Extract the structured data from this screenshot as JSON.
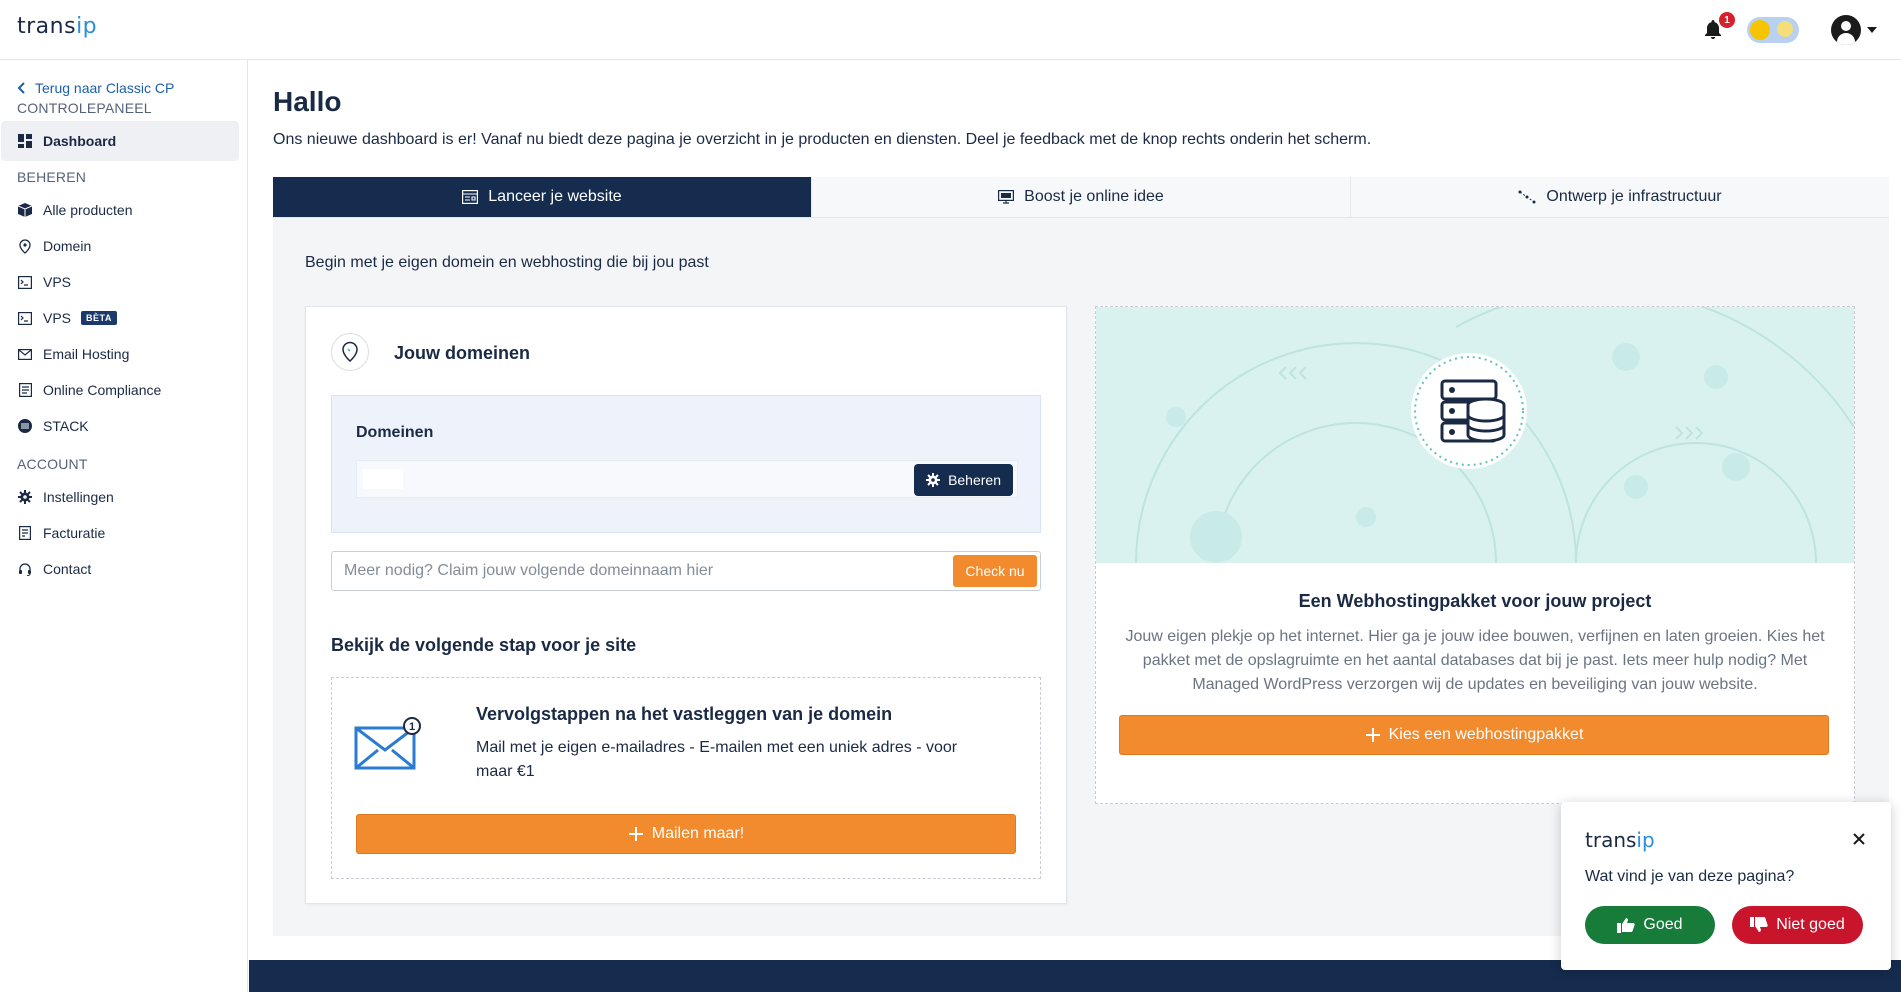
{
  "header": {
    "logo_trans": "trans",
    "logo_ip": "ip",
    "notifications_count": "1"
  },
  "sidebar": {
    "back_link": "Terug naar Classic CP",
    "sections": {
      "control": "CONTROLEPANEEL",
      "manage": "BEHEREN",
      "account": "ACCOUNT"
    },
    "items": [
      {
        "label": "Dashboard",
        "icon": "dashboard-icon"
      },
      {
        "label": "Alle producten",
        "icon": "box-icon"
      },
      {
        "label": "Domein",
        "icon": "location-pin-icon"
      },
      {
        "label": "VPS",
        "icon": "terminal-icon"
      },
      {
        "label": "VPS",
        "icon": "terminal-icon",
        "badge": "BÈTA"
      },
      {
        "label": "Email Hosting",
        "icon": "mail-icon"
      },
      {
        "label": "Online Compliance",
        "icon": "document-icon"
      },
      {
        "label": "STACK",
        "icon": "stack-icon"
      },
      {
        "label": "Instellingen",
        "icon": "gear-icon"
      },
      {
        "label": "Facturatie",
        "icon": "invoice-icon"
      },
      {
        "label": "Contact",
        "icon": "headset-icon"
      }
    ]
  },
  "main": {
    "title": "Hallo",
    "intro": "Ons nieuwe dashboard is er! Vanaf nu biedt deze pagina je overzicht in je producten en diensten. Deel je feedback met de knop rechts onderin het scherm.",
    "tabs": [
      {
        "label": "Lanceer je website",
        "icon": "website-icon"
      },
      {
        "label": "Boost je online idee",
        "icon": "monitor-icon"
      },
      {
        "label": "Ontwerp je infrastructuur",
        "icon": "network-icon"
      }
    ],
    "panel_subtitle": "Begin met je eigen domein en webhosting die bij jou past",
    "domain_card": {
      "title": "Jouw domeinen",
      "domains_label": "Domeinen",
      "manage_label": "Beheren",
      "claim_placeholder": "Meer nodig? Claim jouw volgende domeinnaam hier",
      "check_label": "Check nu",
      "next_step_title": "Bekijk de volgende stap voor je site",
      "step_title": "Vervolgstappen na het vastleggen van je domein",
      "step_desc": "Mail met je eigen e-mailadres - E-mailen met een uniek adres - voor maar €1",
      "step_badge": "1",
      "step_button": "Mailen maar!"
    },
    "webhost_card": {
      "title": "Een Webhostingpakket voor jouw project",
      "desc": "Jouw eigen plekje op het internet. Hier ga je jouw idee bouwen, verfijnen en laten groeien. Kies het pakket met de opslagruimte en het aantal databases dat bij je past. Iets meer hulp nodig? Met Managed WordPress verzorgen wij de updates en beveiliging van jouw website.",
      "button": "Kies een webhostingpakket"
    }
  },
  "feedback": {
    "logo_trans": "trans",
    "logo_ip": "ip",
    "question": "Wat vind je van deze pagina?",
    "good": "Goed",
    "bad": "Niet goed"
  },
  "colors": {
    "navy": "#152c4f",
    "orange": "#f28a2e",
    "green": "#177b3a",
    "red": "#c8152c",
    "link_blue": "#1c5fab"
  }
}
